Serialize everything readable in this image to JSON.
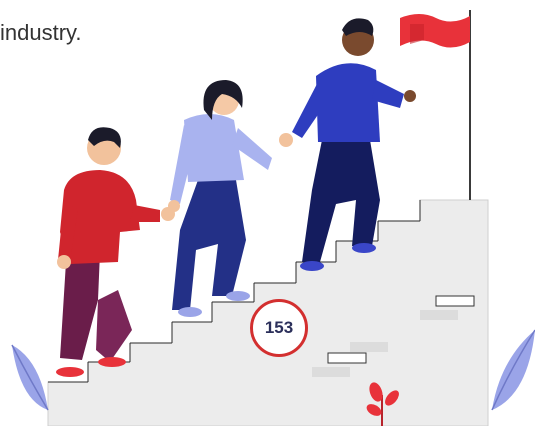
{
  "caption": {
    "line1": "industry."
  },
  "page_badge": "153",
  "colors": {
    "flag": "#e8323a",
    "stairs": "#ececec",
    "badge_border": "#d32f2f",
    "leaves": "#9aa4e8"
  }
}
